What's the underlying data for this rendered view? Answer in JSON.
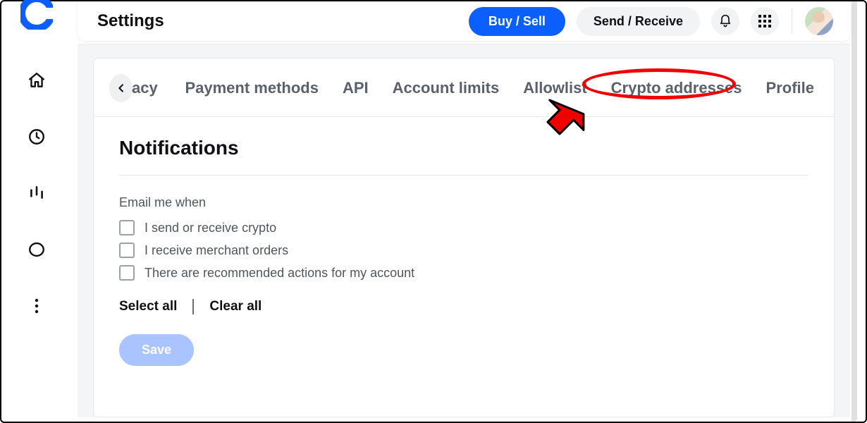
{
  "page_title": "Settings",
  "buttons": {
    "buy_sell": "Buy / Sell",
    "send_receive": "Send / Receive",
    "save": "Save"
  },
  "tabs": {
    "partial_prev": "acy",
    "payment_methods": "Payment methods",
    "api": "API",
    "account_limits": "Account limits",
    "allowlist": "Allowlist",
    "crypto_addresses": "Crypto addresses",
    "profile": "Profile"
  },
  "section": {
    "heading": "Notifications",
    "subheading": "Email me when",
    "options": {
      "opt1": "I send or receive crypto",
      "opt2": "I receive merchant orders",
      "opt3": "There are recommended actions for my account"
    },
    "select_all": "Select all",
    "clear_all": "Clear all"
  }
}
